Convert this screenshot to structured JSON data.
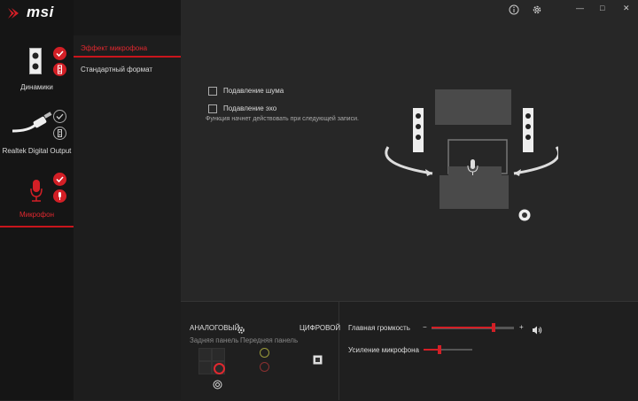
{
  "app": {
    "logo_text": "msi"
  },
  "window": {
    "info_icon": "info-icon",
    "settings_icon": "gear-icon",
    "minimize": "—",
    "maximize": "□",
    "close": "✕"
  },
  "devices": [
    {
      "label": "Динамики",
      "icon": "speakers-icon",
      "default": true
    },
    {
      "label": "Realtek Digital Output",
      "icon": "digital-cable-icon",
      "default": false
    },
    {
      "label": "Микрофон",
      "icon": "microphone-icon",
      "default": true,
      "active": true
    }
  ],
  "tabs": [
    {
      "label": "Эффект микрофона",
      "active": true
    },
    {
      "label": "Стандартный формат",
      "active": false
    }
  ],
  "effects": {
    "noise_suppression": {
      "label": "Подавление шума",
      "checked": false
    },
    "echo_cancellation": {
      "label": "Подавление эхо",
      "checked": false
    },
    "hint": "Функция начнет действовать при следующей записи."
  },
  "connectors": {
    "analog_label": "АНАЛОГОВЫЙ",
    "digital_label": "ЦИФРОВОЙ",
    "rear_panel": "Задняя панель",
    "front_panel": "Передняя панель"
  },
  "volume": {
    "main_label": "Главная громкость",
    "main_level": 0.8,
    "minus": "−",
    "plus": "+",
    "boost_label": "Усиление микрофона",
    "boost_level": 0.3
  },
  "colors": {
    "accent": "#d31f26",
    "bg": "#222222"
  }
}
